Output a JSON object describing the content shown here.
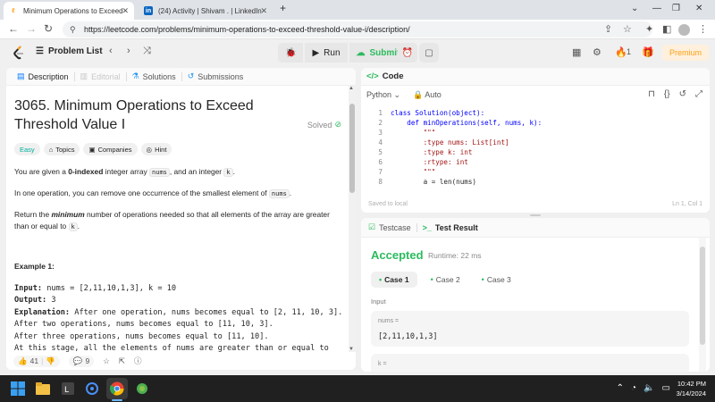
{
  "browser": {
    "tabs": [
      {
        "title": "Minimum Operations to Exceed",
        "active": true
      },
      {
        "title": "(24) Activity | Shivam . | LinkedIn",
        "active": false
      }
    ],
    "new_tab": "+",
    "url": "https://leetcode.com/problems/minimum-operations-to-exceed-threshold-value-i/description/"
  },
  "lcnav": {
    "problem_list": "Problem List",
    "run_label": "Run",
    "submit_label": "Submit",
    "streak_count": "1",
    "premium_label": "Premium"
  },
  "left": {
    "tabs": [
      "Description",
      "Editorial",
      "Solutions",
      "Submissions"
    ],
    "title": "3065. Minimum Operations to Exceed Threshold Value I",
    "solved": "Solved",
    "chips": [
      "Easy",
      "Topics",
      "Companies",
      "Hint"
    ],
    "p1_pre": "You are given a ",
    "p1_bold": "0-indexed",
    "p1_mid": " integer array ",
    "p1_code1": "nums",
    "p1_mid2": ", and an integer ",
    "p1_code2": "k",
    "p1_end": ".",
    "p2_pre": "In one operation, you can remove one occurrence of the smallest element of ",
    "p2_code": "nums",
    "p2_end": ".",
    "p3_pre": "Return the ",
    "p3_bold": "minimum",
    "p3_mid": " number of operations needed so that all elements of the array are greater than or equal to ",
    "p3_code": "k",
    "p3_end": ".",
    "example_heading": "Example 1:",
    "ex_input_label": "Input:",
    "ex_input": " nums = [2,11,10,1,3], k = 10",
    "ex_output_label": "Output:",
    "ex_output": " 3",
    "ex_expl_label": "Explanation:",
    "ex_expl1": " After one operation, nums becomes equal to [2, 11, 10, 3].",
    "ex_expl2": "After two operations, nums becomes equal to [11, 10, 3].",
    "ex_expl3": "After three operations, nums becomes equal to [11, 10].",
    "ex_expl4": "At this stage, all the elements of nums are greater than or equal to",
    "likes": "41",
    "comments": "9"
  },
  "code": {
    "header": "Code",
    "language": "Python",
    "auto": "Auto",
    "lines": [
      "class Solution(object):",
      "    def minOperations(self, nums, k):",
      "        \"\"\"",
      "        :type nums: List[int]",
      "        :type k: int",
      "        :rtype: int",
      "        \"\"\"",
      "        a = len(nums)"
    ],
    "line_numbers": [
      "1",
      "2",
      "3",
      "4",
      "5",
      "6",
      "7",
      "8"
    ],
    "saved": "Saved to local",
    "cursor": "Ln 1, Col 1"
  },
  "result": {
    "tabs": [
      "Testcase",
      "Test Result"
    ],
    "status": "Accepted",
    "runtime": "Runtime: 22 ms",
    "cases": [
      "Case 1",
      "Case 2",
      "Case 3"
    ],
    "input_label": "Input",
    "var1_label": "nums =",
    "var1_value": "[2,11,10,1,3]",
    "var2_label": "k ="
  },
  "taskbar": {
    "time": "10:42 PM",
    "date": "3/14/2024"
  },
  "colors": {
    "accent_green": "#2cbb5d",
    "easy": "#00af9b",
    "premium": "#ffa116"
  }
}
